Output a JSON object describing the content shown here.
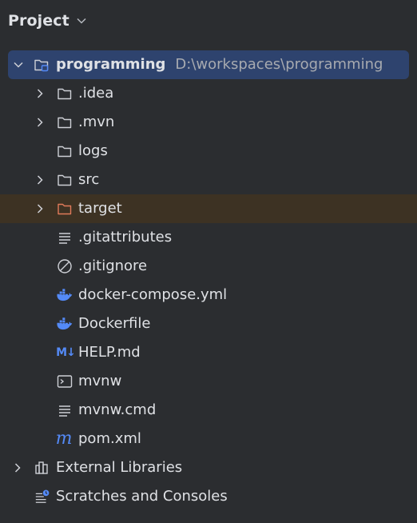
{
  "header": {
    "title": "Project"
  },
  "tree": {
    "root": {
      "label": "programming",
      "path": "D:\\workspaces\\programming"
    },
    "items": [
      {
        "label": ".idea"
      },
      {
        "label": ".mvn"
      },
      {
        "label": "logs"
      },
      {
        "label": "src"
      },
      {
        "label": "target"
      },
      {
        "label": ".gitattributes"
      },
      {
        "label": ".gitignore"
      },
      {
        "label": "docker-compose.yml"
      },
      {
        "label": "Dockerfile"
      },
      {
        "label": "HELP.md",
        "icon_text": "M↓"
      },
      {
        "label": "mvnw"
      },
      {
        "label": "mvnw.cmd"
      },
      {
        "label": "pom.xml",
        "icon_text": "m"
      }
    ],
    "external_libraries": {
      "label": "External Libraries"
    },
    "scratches": {
      "label": "Scratches and Consoles"
    }
  },
  "colors": {
    "background": "#2b2d30",
    "selected_row": "#2e436e",
    "excluded_row": "#3d3223",
    "excluded_folder": "#e07a5a",
    "accent_blue": "#548af7"
  }
}
